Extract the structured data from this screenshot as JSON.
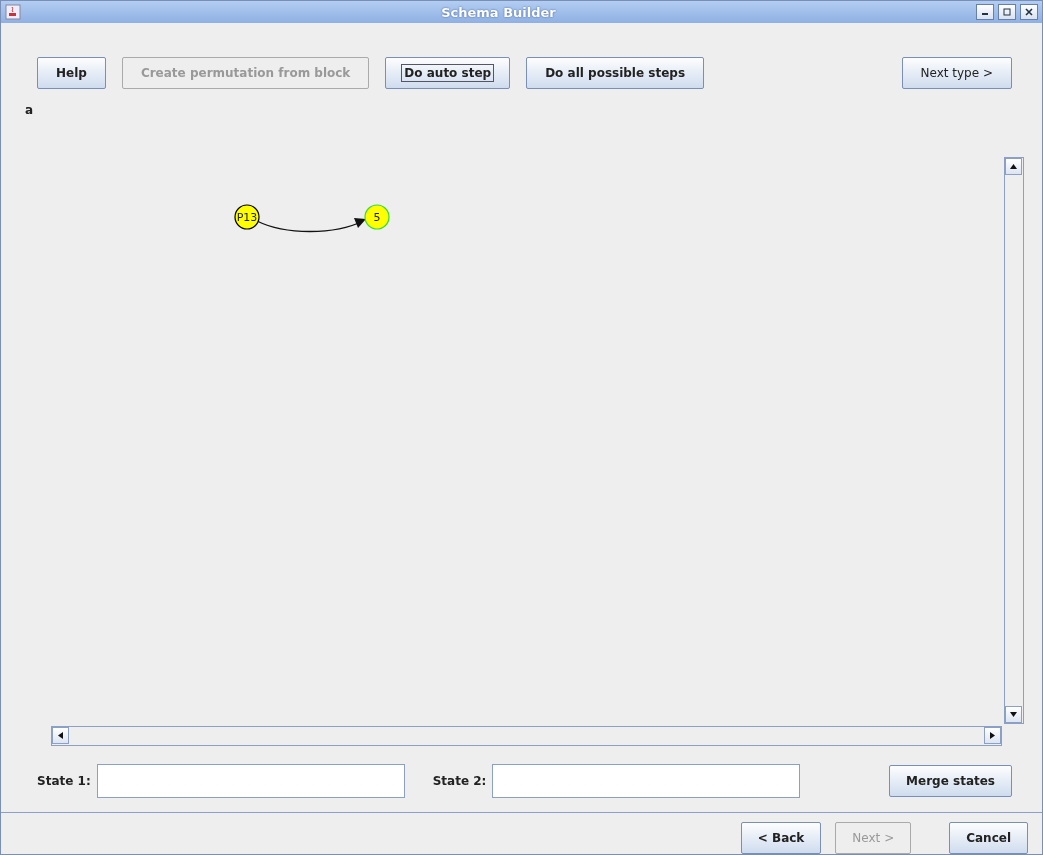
{
  "window": {
    "title": "Schema Builder"
  },
  "toolbar": [
    {
      "label": "Help",
      "disabled": false,
      "focused": false,
      "bold": true
    },
    {
      "label": "Create permutation from block",
      "disabled": true,
      "focused": false,
      "bold": true
    },
    {
      "label": "Do auto step",
      "disabled": false,
      "focused": true,
      "bold": true
    },
    {
      "label": "Do all possible steps",
      "disabled": false,
      "focused": false,
      "bold": true
    },
    {
      "label": "Next type >",
      "disabled": false,
      "focused": false,
      "bold": false
    }
  ],
  "graph_label": "a",
  "graph": {
    "nodes": [
      {
        "label": "P13",
        "color": "#ffff00",
        "highlighted": false
      },
      {
        "label": "5",
        "color": "#ffff00",
        "highlighted": true
      }
    ]
  },
  "merge": {
    "fields": [
      {
        "label": "State 1:"
      },
      {
        "label": "State 2:"
      }
    ],
    "button": {
      "label": "Merge states",
      "disabled": false
    }
  },
  "footer": [
    {
      "label": "< Back",
      "disabled": false
    },
    {
      "label": "Next >",
      "disabled": true
    },
    {
      "label": "Cancel",
      "disabled": false
    }
  ]
}
